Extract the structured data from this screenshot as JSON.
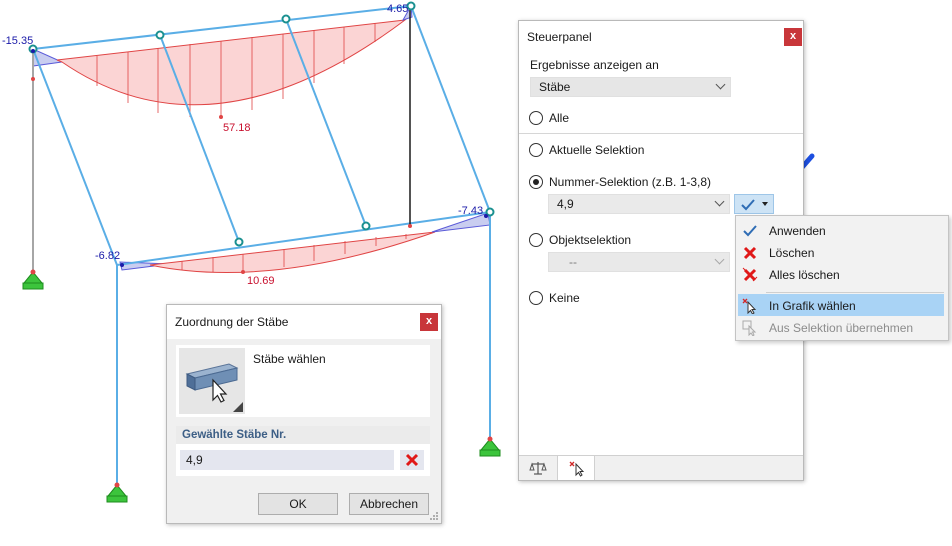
{
  "model": {
    "result_labels": {
      "top_left_moment": "-15.35",
      "top_right_moment": "4.65",
      "top_max_moment": "57.18",
      "mid_left_moment": "-6.82",
      "mid_right_moment": "-7.43",
      "mid_max_moment": "10.69"
    },
    "colors": {
      "member_line": "#5aaee6",
      "negative_fill": "#c9cdf0",
      "positive_fill": "#fbd4d4",
      "hatch": "#e04545",
      "support": "#3cc43c",
      "node": "#1a9090"
    }
  },
  "panel": {
    "title": "Steuerpanel",
    "close_label": "x",
    "results_label": "Ergebnisse anzeigen an",
    "results_selected": "Stäbe",
    "options": {
      "alle": "Alle",
      "aktuelle": "Aktuelle Selektion",
      "nummer": "Nummer-Selektion (z.B. 1-3,8)",
      "objekt": "Objektselektion",
      "keine": "Keine"
    },
    "number_value": "4,9",
    "object_value": "--",
    "selected_option": "nummer"
  },
  "menu": {
    "apply": "Anwenden",
    "delete": "Löschen",
    "delete_all": "Alles löschen",
    "pick_graphic": "In Grafik wählen",
    "from_selection": "Aus Selektion übernehmen",
    "highlighted": "pick_graphic"
  },
  "dialog": {
    "title": "Zuordnung der Stäbe",
    "close_label": "x",
    "choose_label": "Stäbe wählen",
    "section_header": "Gewählte Stäbe Nr.",
    "members_value": "4,9",
    "ok_label": "OK",
    "cancel_label": "Abbrechen"
  }
}
